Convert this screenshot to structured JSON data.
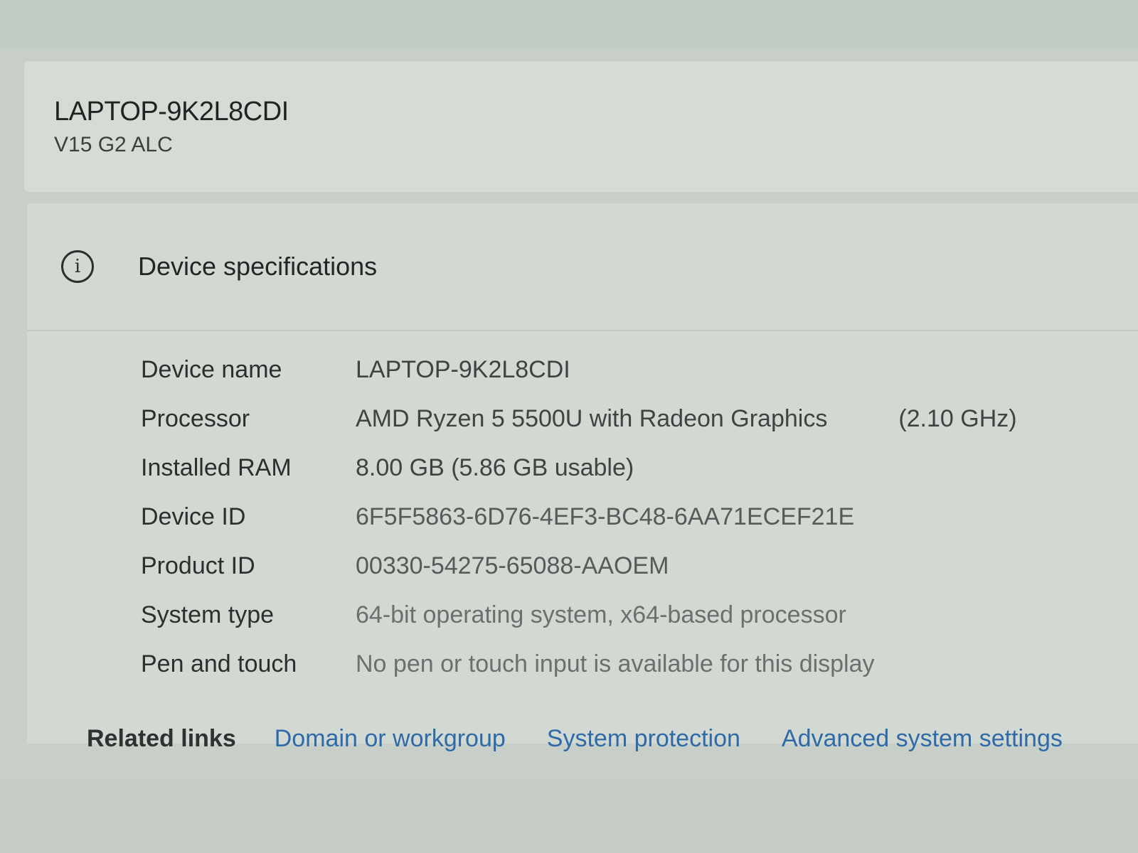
{
  "header": {
    "device_title": "LAPTOP-9K2L8CDI",
    "model": "V15 G2 ALC"
  },
  "specs": {
    "icon": "info-icon",
    "heading": "Device specifications",
    "rows": [
      {
        "label": "Device name",
        "value": "LAPTOP-9K2L8CDI"
      },
      {
        "label": "Processor",
        "value": "AMD Ryzen 5 5500U with Radeon Graphics",
        "extra": "(2.10 GHz)"
      },
      {
        "label": "Installed RAM",
        "value": "8.00 GB (5.86 GB usable)"
      },
      {
        "label": "Device ID",
        "value": "6F5F5863-6D76-4EF3-BC48-6AA71ECEF21E"
      },
      {
        "label": "Product ID",
        "value": "00330-54275-65088-AAOEM"
      },
      {
        "label": "System type",
        "value": "64-bit operating system, x64-based processor"
      },
      {
        "label": "Pen and touch",
        "value": "No pen or touch input is available for this display"
      }
    ]
  },
  "related": {
    "label": "Related links",
    "links": [
      "Domain or workgroup",
      "System protection",
      "Advanced system settings"
    ]
  },
  "colors": {
    "link": "#2f6aa8",
    "card": "#d2d9d3",
    "background": "#c8cfc8"
  }
}
